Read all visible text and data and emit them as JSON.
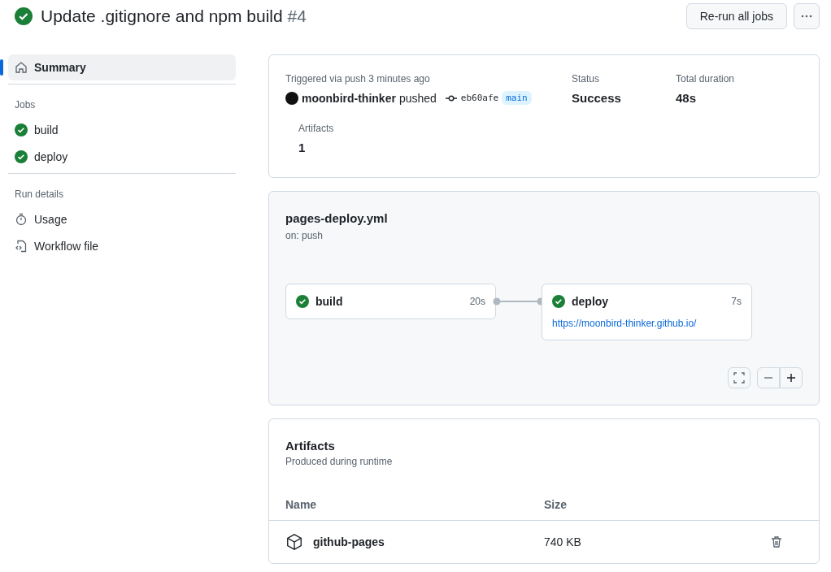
{
  "header": {
    "title": "Update .gitignore and npm build",
    "run_number": "#4",
    "succeeded": true,
    "buttons": [
      "Re-run all jobs"
    ]
  },
  "sidebar": {
    "items": [
      {
        "label": "Summary",
        "kind": "home",
        "selected": true
      }
    ],
    "sections": [
      {
        "heading": "Jobs",
        "items": [
          {
            "label": "build",
            "kind": "job",
            "selected": false
          },
          {
            "label": "deploy",
            "kind": "job",
            "selected": false
          }
        ]
      },
      {
        "heading": "Run details",
        "items": [
          {
            "label": "Usage",
            "kind": "usage",
            "selected": false
          },
          {
            "label": "Workflow file",
            "kind": "file",
            "selected": false
          }
        ]
      }
    ]
  },
  "summary": {
    "trigger": "Triggered via push 3 minutes ago",
    "actor": "moonbird-thinker",
    "action": "pushed",
    "commit": "eb60afe",
    "branch": "main",
    "stats": [
      {
        "label": "Status",
        "value": "Success"
      },
      {
        "label": "Total duration",
        "value": "48s"
      }
    ],
    "artifacts": {
      "label": "Artifacts",
      "value": "1"
    }
  },
  "workflow": {
    "file": "pages-deploy.yml",
    "trigger": "on: push",
    "jobs": [
      {
        "name": "build",
        "succeeded": true,
        "duration": "20s"
      },
      {
        "name": "deploy",
        "succeeded": true,
        "duration": "7s",
        "link": "https://moonbird-thinker.github.io/"
      }
    ]
  },
  "artifacts": {
    "title": "Artifacts",
    "subtitle": "Produced during runtime",
    "columns": [
      "Name",
      "Size"
    ],
    "rows": [
      {
        "name": "github-pages",
        "size": "740 KB"
      }
    ]
  }
}
